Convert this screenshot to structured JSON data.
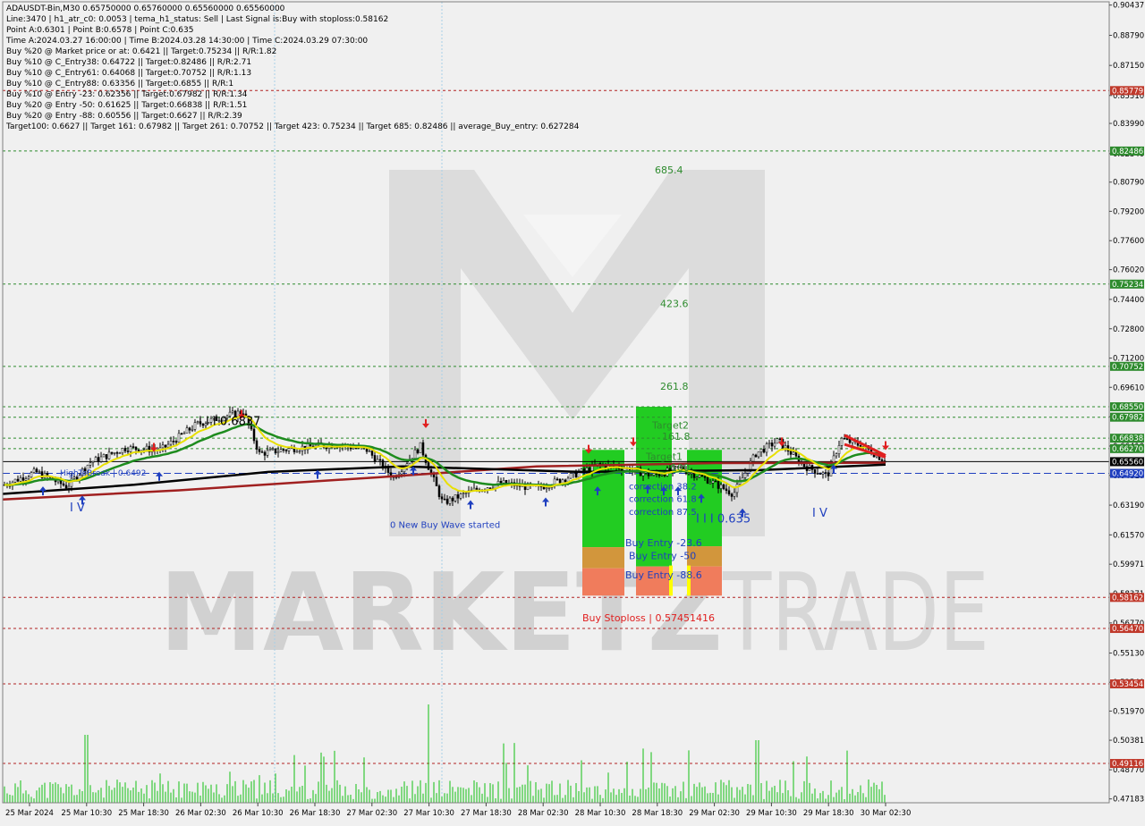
{
  "info_lines": [
    "ADAUSDT-Bin,M30  0.65750000 0.65760000 0.65560000 0.65560000",
    "Line:3470 | h1_atr_c0: 0.0053 | tema_h1_status: Sell | Last Signal is:Buy with stoploss:0.58162",
    "Point A:0.6301 | Point B:0.6578 | Point C:0.635",
    "Time A:2024.03.27 16:00:00 | Time B:2024.03.28 14:30:00 | Time C:2024.03.29 07:30:00",
    "Buy %20 @ Market price or at: 0.6421 || Target:0.75234 || R/R:1.82",
    "Buy %10 @ C_Entry38: 0.64722 || Target:0.82486 || R/R:2.71",
    "Buy %10 @ C_Entry61: 0.64068 || Target:0.70752 || R/R:1.13",
    "Buy %10 @ C_Entry88: 0.63356 || Target:0.6855 || R/R:1",
    "Buy %10 @ Entry -23: 0.62356 || Target:0.67982 || R/R:1.34",
    "Buy %20 @ Entry -50: 0.61625 || Target:0.66838 || R/R:1.51",
    "Buy %20 @ Entry -88: 0.60556 || Target:0.6627 || R/R:2.39",
    "Target100: 0.6627 || Target 161: 0.67982 || Target 261: 0.70752 || Target 423: 0.75234 || Target 685: 0.82486 || average_Buy_entry: 0.627284"
  ],
  "watermark": {
    "logo": "M",
    "word1": "MARKETZ",
    "word2": "TRADE"
  },
  "colors": {
    "background": "#f0f0f0",
    "green_level": "#2e8b2e",
    "red_level": "#b22222",
    "current_price": "#000000",
    "bid_line": "#1f3fbf",
    "ema_yellow": "#e8e000",
    "ema_green": "#1e8c1e",
    "ema_black": "#000000",
    "ema_darkred": "#a02020",
    "volume": "#12c012"
  },
  "chart_data": {
    "type": "candlestick",
    "symbol": "ADAUSDT-Bin",
    "timeframe": "M30",
    "ylim": [
      0.4712,
      0.9047
    ],
    "y_ticks": [
      "0.90437",
      "0.88790",
      "0.87150",
      "0.85510",
      "0.83990",
      "0.82340",
      "0.80790",
      "0.79200",
      "0.77600",
      "0.76020",
      "0.74400",
      "0.72800",
      "0.71200",
      "0.69610",
      "0.68010",
      "0.66410",
      "0.64810",
      "0.63190",
      "0.61570",
      "0.59971",
      "0.58371",
      "0.56770",
      "0.55130",
      "0.53540",
      "0.51970",
      "0.50381",
      "0.48770",
      "0.47183"
    ],
    "x_labels": [
      "25 Mar 2024",
      "25 Mar 10:30",
      "25 Mar 18:30",
      "26 Mar 02:30",
      "26 Mar 10:30",
      "26 Mar 18:30",
      "27 Mar 02:30",
      "27 Mar 10:30",
      "27 Mar 18:30",
      "28 Mar 02:30",
      "28 Mar 10:30",
      "28 Mar 18:30",
      "29 Mar 02:30",
      "29 Mar 10:30",
      "29 Mar 18:30",
      "30 Mar 02:30"
    ],
    "levels": [
      {
        "value": 0.85779,
        "label": "0.85779",
        "color": "red",
        "style": "dashed"
      },
      {
        "value": 0.82486,
        "label": "0.82486",
        "color": "green",
        "style": "dashed",
        "fib": "685.4"
      },
      {
        "value": 0.75234,
        "label": "0.75234",
        "color": "green",
        "style": "dashed",
        "fib": "423.6"
      },
      {
        "value": 0.70752,
        "label": "0.70752",
        "color": "green",
        "style": "dashed",
        "fib": "261.8"
      },
      {
        "value": 0.6855,
        "label": "0.68550",
        "color": "green",
        "style": "dashed"
      },
      {
        "value": 0.67982,
        "label": "0.67982",
        "color": "green",
        "style": "dashed"
      },
      {
        "value": 0.66838,
        "label": "0.66838",
        "color": "green",
        "style": "dashed"
      },
      {
        "value": 0.6627,
        "label": "0.66270",
        "color": "green",
        "style": "dashed"
      },
      {
        "value": 0.6556,
        "label": "0.65560",
        "color": "black",
        "style": "solid"
      },
      {
        "value": 0.6492,
        "label": "0.64920",
        "color": "blue",
        "style": "dashed"
      },
      {
        "value": 0.58162,
        "label": "0.58162",
        "color": "red",
        "style": "dashed"
      },
      {
        "value": 0.5647,
        "label": "0.56470",
        "color": "red",
        "style": "dashed"
      },
      {
        "value": 0.5345,
        "label": "0.53454",
        "color": "red",
        "style": "dashed"
      },
      {
        "value": 0.49116,
        "label": "0.49116",
        "color": "red",
        "style": "dashed"
      }
    ],
    "annotations": [
      {
        "text": "685.4",
        "value": 0.8145
      },
      {
        "text": "423.6",
        "value": 0.7418
      },
      {
        "text": "261.8",
        "value": 0.6968
      },
      {
        "text": "Target2",
        "value": 0.6755
      },
      {
        "text": "161.8",
        "value": 0.6695
      },
      {
        "text": "Target1",
        "value": 0.6585
      },
      {
        "text": "100",
        "value": 0.6525
      },
      {
        "text": "I I I 0.6837",
        "value": 0.6775
      },
      {
        "text": "I I I 0.635",
        "value": 0.6244
      },
      {
        "text": "I V",
        "value": 0.6305
      },
      {
        "text": "I V",
        "value": 0.6275
      },
      {
        "text": "0 New Buy Wave started",
        "value": 0.6215
      },
      {
        "text": "correction 38.2",
        "value": 0.6425
      },
      {
        "text": "correction 61.8",
        "value": 0.6355
      },
      {
        "text": "correction 87.5",
        "value": 0.6285
      },
      {
        "text": "Buy Entry -23.6",
        "value": 0.6115
      },
      {
        "text": "Buy Entry -50",
        "value": 0.6045
      },
      {
        "text": "Buy Entry -88.6",
        "value": 0.594
      },
      {
        "text": "Buy Stoploss | 0.57451416",
        "value": 0.5705
      },
      {
        "text": "HighToBreak | 0.6492",
        "value": 0.65
      }
    ]
  }
}
